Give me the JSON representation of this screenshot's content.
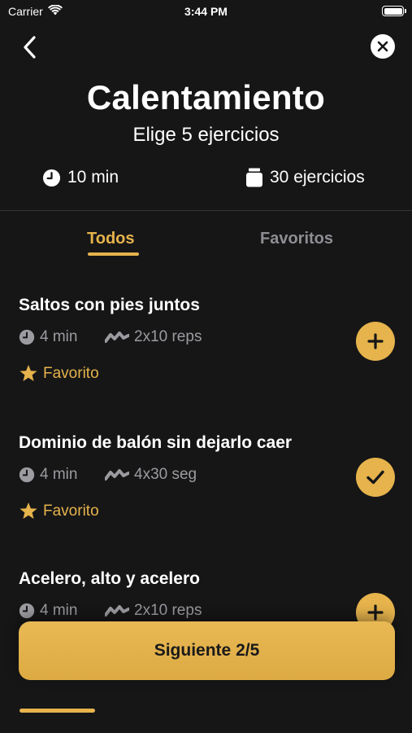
{
  "status_bar": {
    "carrier": "Carrier",
    "time": "3:44 PM"
  },
  "header": {
    "title": "Calentamiento",
    "subtitle": "Elige 5 ejercicios",
    "duration": "10 min",
    "exercise_count": "30 ejercicios"
  },
  "tabs": [
    {
      "label": "Todos",
      "active": true
    },
    {
      "label": "Favoritos",
      "active": false
    }
  ],
  "exercises": [
    {
      "title": "Saltos con pies juntos",
      "duration": "4 min",
      "reps": "2x10 reps",
      "favorite_label": "Favorito",
      "selected": false
    },
    {
      "title": "Dominio de balón sin dejarlo caer",
      "duration": "4 min",
      "reps": "4x30 seg",
      "favorite_label": "Favorito",
      "selected": true
    },
    {
      "title": "Acelero, alto y acelero",
      "duration": "4 min",
      "reps": "2x10 reps",
      "favorite_label": "",
      "selected": false
    }
  ],
  "footer": {
    "next_label": "Siguiente 2/5"
  },
  "colors": {
    "background": "#161617",
    "accent": "#E6B34C",
    "muted": "#9b9ba0",
    "inactive_tab": "#8e8e93"
  },
  "icons": {
    "back": "chevron-left-icon",
    "close": "close-icon",
    "clock": "clock-icon",
    "count": "cup-icon",
    "reps": "wave-icon",
    "star": "star-icon",
    "add": "plus-icon",
    "selected": "checkmark-icon"
  }
}
